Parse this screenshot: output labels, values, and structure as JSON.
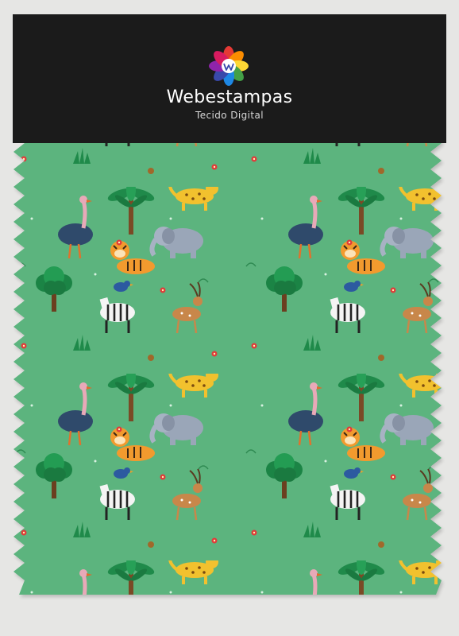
{
  "brand": {
    "name": "Webestampas",
    "subtitle": "Tecido Digital",
    "logo_icon": "rainbow-flower-w-logo-icon"
  },
  "colors": {
    "background": "#e6e6e4",
    "header_panel": "#1b1b1b",
    "fabric_green": "#5cb47e",
    "brand_text": "#ffffff"
  },
  "fabric": {
    "pattern": "safari-animals",
    "motifs": [
      "ostrich",
      "elephant",
      "leopard",
      "tiger",
      "zebra",
      "gazelle",
      "palm-tree",
      "bird",
      "flower"
    ]
  }
}
